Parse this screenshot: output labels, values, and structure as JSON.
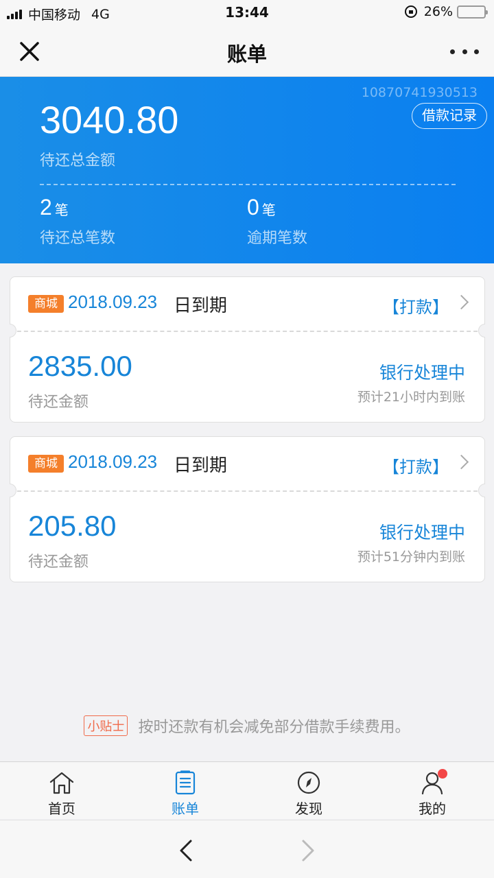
{
  "status_bar": {
    "carrier": "中国移动",
    "network": "4G",
    "time": "13:44",
    "battery": "26%",
    "battery_level": 0.26
  },
  "nav": {
    "title": "账单"
  },
  "summary": {
    "account_no": "10870741930513",
    "record_button": "借款记录",
    "total_amount": "3040.80",
    "total_label": "待还总金额",
    "pending_count": "2",
    "pending_unit": "笔",
    "pending_label": "待还总笔数",
    "overdue_count": "0",
    "overdue_unit": "笔",
    "overdue_label": "逾期笔数"
  },
  "bills": [
    {
      "tag": "商城",
      "due_date": "2018.09.23",
      "due_suffix": "日到期",
      "action": "【打款】",
      "amount": "2835.00",
      "amount_label": "待还金额",
      "status": "银行处理中",
      "eta": "预计21小时内到账"
    },
    {
      "tag": "商城",
      "due_date": "2018.09.23",
      "due_suffix": "日到期",
      "action": "【打款】",
      "amount": "205.80",
      "amount_label": "待还金额",
      "status": "银行处理中",
      "eta": "预计51分钟内到账"
    }
  ],
  "tip": {
    "badge": "小贴士",
    "text": "按时还款有机会减免部分借款手续费用。"
  },
  "tabs": [
    {
      "label": "首页",
      "icon": "home-icon"
    },
    {
      "label": "账单",
      "icon": "bill-icon",
      "active": true
    },
    {
      "label": "发现",
      "icon": "compass-icon"
    },
    {
      "label": "我的",
      "icon": "user-icon",
      "has_badge": true
    }
  ],
  "colors": {
    "primary": "#1785d8",
    "banner": "#0a7ff0",
    "tag": "#f47f2b",
    "badge": "#f34747"
  }
}
